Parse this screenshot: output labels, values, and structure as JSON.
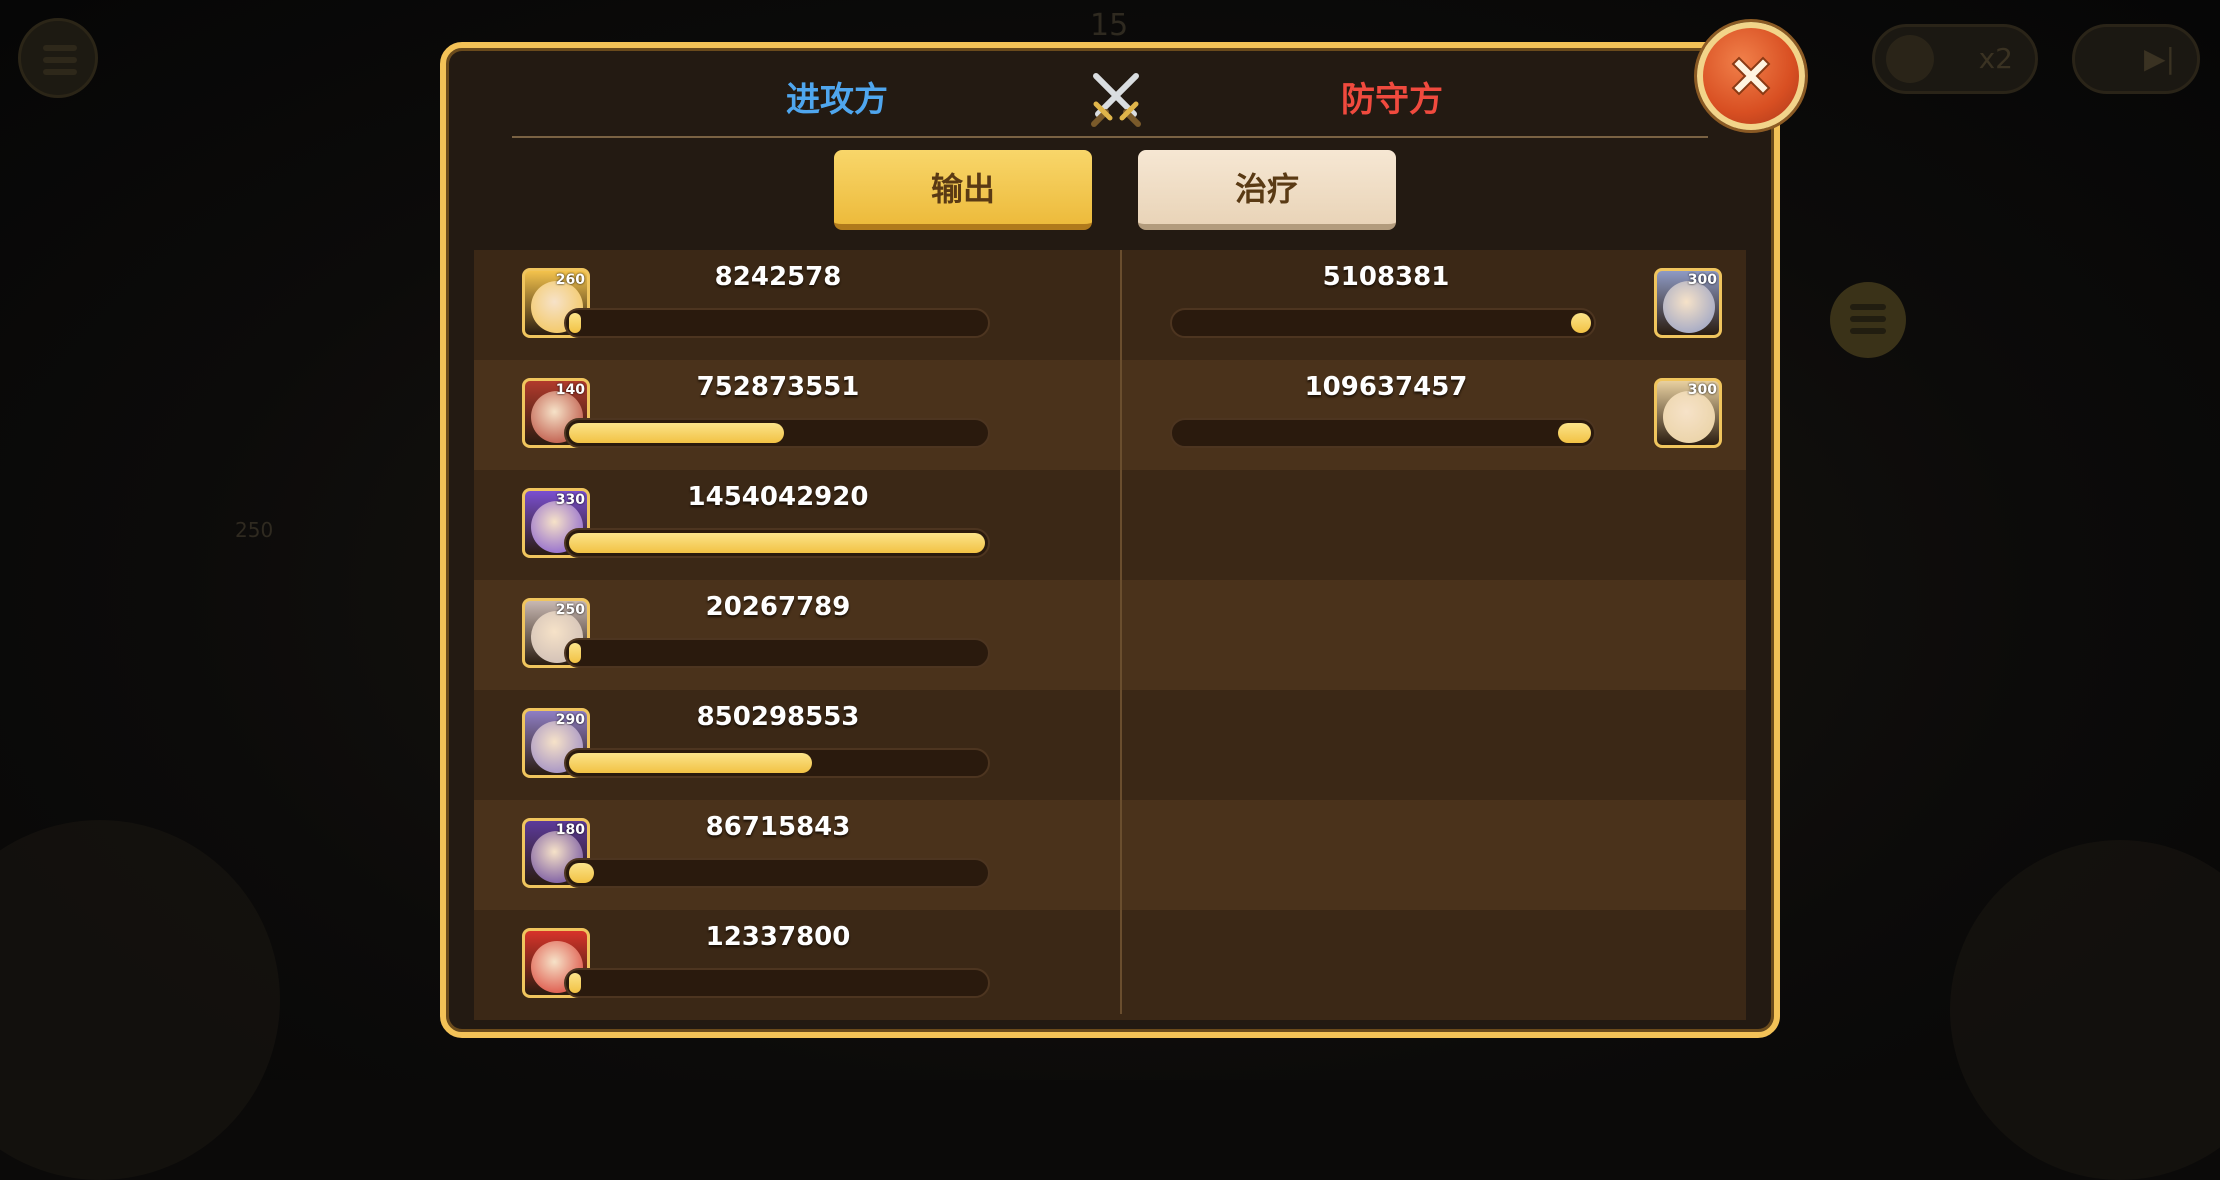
{
  "background": {
    "wave_number": "15",
    "speed_label": "x2",
    "side_number": "250"
  },
  "header": {
    "attacker_label": "进攻方",
    "defender_label": "防守方",
    "attacker_color": "#4fa6ee",
    "defender_color": "#f04a3e",
    "center_icon": "crossed-swords-icon"
  },
  "tabs": [
    {
      "label": "输出",
      "selected": true
    },
    {
      "label": "治疗",
      "selected": false
    }
  ],
  "attackers": [
    {
      "level": "260",
      "value": "8242578",
      "fill_ratio": 0.006,
      "portrait_color": "#f3c24c"
    },
    {
      "level": "140",
      "value": "752873551",
      "fill_ratio": 0.518,
      "portrait_color": "#b23a2c"
    },
    {
      "level": "330",
      "value": "1454042920",
      "fill_ratio": 1.0,
      "portrait_color": "#7a4fd0"
    },
    {
      "level": "250",
      "value": "20267789",
      "fill_ratio": 0.014,
      "portrait_color": "#c8b8b2"
    },
    {
      "level": "290",
      "value": "850298553",
      "fill_ratio": 0.585,
      "portrait_color": "#8f7ec4"
    },
    {
      "level": "180",
      "value": "86715843",
      "fill_ratio": 0.06,
      "portrait_color": "#5c3a9a"
    },
    {
      "level": "",
      "value": "12337800",
      "fill_ratio": 0.008,
      "portrait_color": "#d8342a"
    }
  ],
  "defenders": [
    {
      "level": "300",
      "value": "5108381",
      "fill_ratio": 0.047,
      "portrait_color": "#8e9ac4"
    },
    {
      "level": "300",
      "value": "109637457",
      "fill_ratio": 0.08,
      "portrait_color": "#e8d0a0"
    }
  ],
  "close_icon": "close-x-icon"
}
